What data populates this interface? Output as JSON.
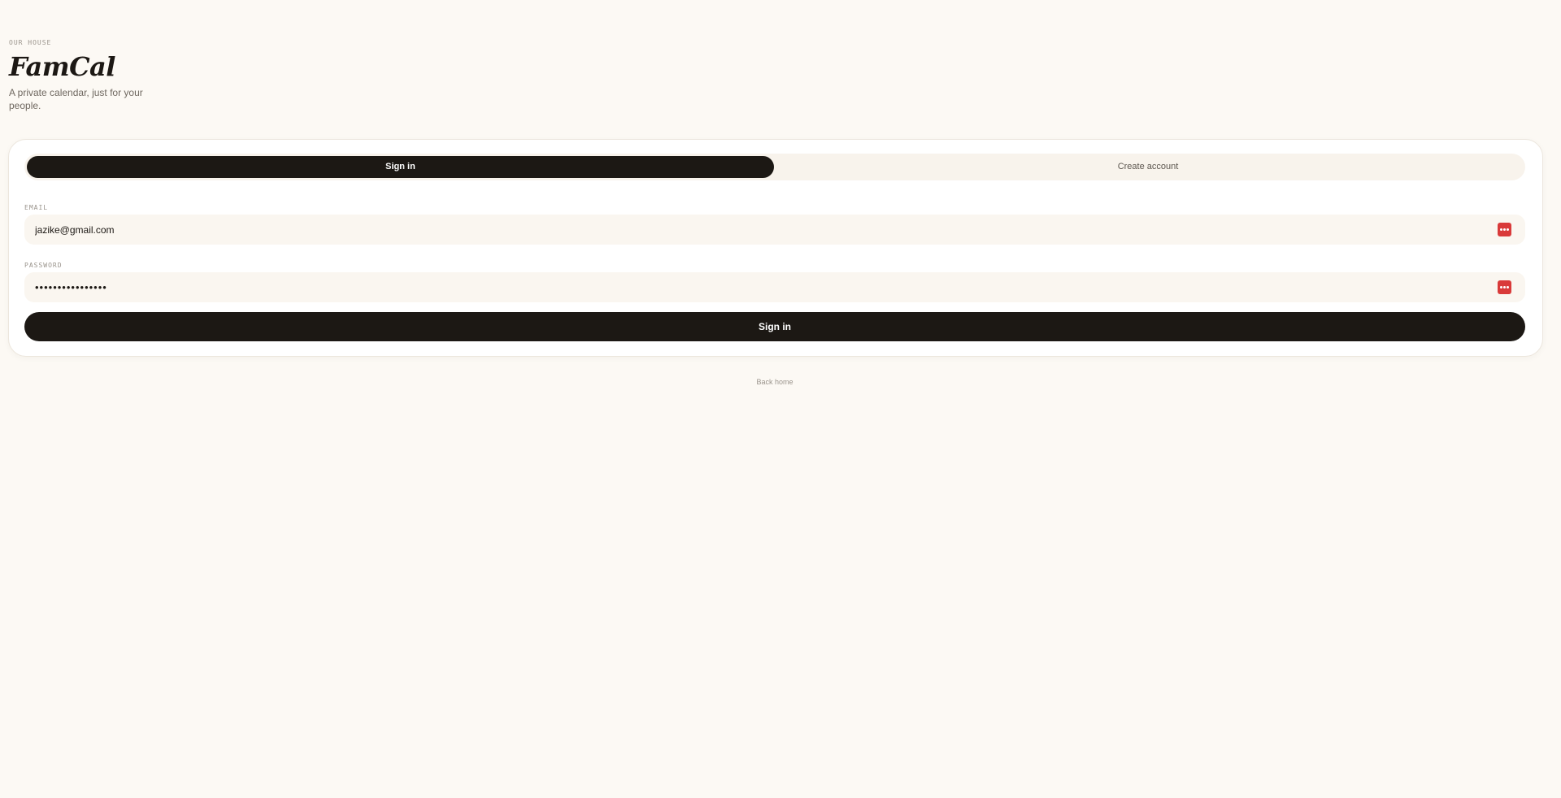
{
  "header": {
    "eyebrow": "OUR HOUSE",
    "title": "FamCal",
    "subtitle": "A private calendar, just for your people."
  },
  "tabs": {
    "sign_in": "Sign in",
    "create_account": "Create account",
    "active": "Sign in"
  },
  "form": {
    "email_label": "EMAIL",
    "email_value": "jazike@gmail.com",
    "password_label": "PASSWORD",
    "password_value": "••••••••••••••••",
    "submit_label": "Sign in",
    "manager_icon": "password-manager-icon"
  },
  "footer": {
    "back_home": "Back home"
  },
  "colors": {
    "background": "#fcf9f4",
    "primary": "#1c1814",
    "field_background": "#faf6f0",
    "manager_icon": "#d93a3a"
  }
}
